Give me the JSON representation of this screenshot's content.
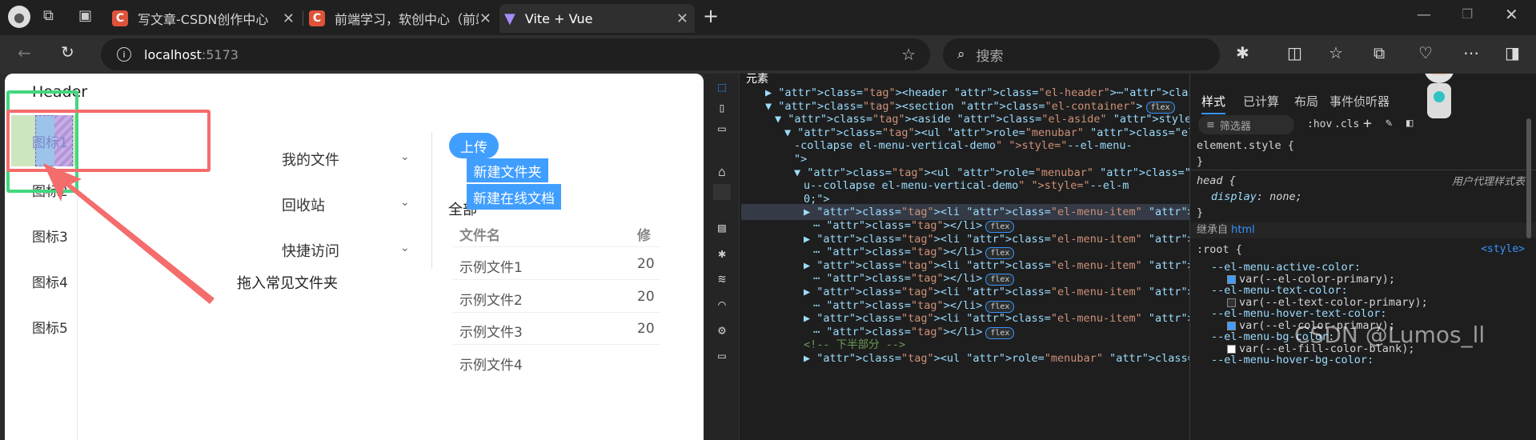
{
  "browser": {
    "tabs": [
      {
        "label": "写文章-CSDN创作中心",
        "favicon": "C"
      },
      {
        "label": "前端学习，软创中心（前端组）—",
        "favicon": "C"
      },
      {
        "label": "Vite + Vue",
        "favicon": "V"
      }
    ],
    "url_host": "localhost",
    "url_port": ":5173",
    "search_placeholder": "搜索"
  },
  "app": {
    "header": "Header",
    "aside_items": [
      "图标1",
      "图标2",
      "图标3",
      "图标4",
      "图标5"
    ],
    "menu_items": [
      "我的文件",
      "回收站",
      "快捷访问"
    ],
    "drag_hint": "拖入常见文件夹",
    "upload_button": "上传",
    "dropdown": [
      "新建文件夹",
      "新建在线文档"
    ],
    "all_files_label": "全部",
    "table_headers": [
      "文件名",
      "修"
    ],
    "table_rows": [
      {
        "name": "示例文件1",
        "date": "20"
      },
      {
        "name": "示例文件2",
        "date": "20"
      },
      {
        "name": "示例文件3",
        "date": "20"
      },
      {
        "name": "示例文件4",
        "date": ""
      }
    ]
  },
  "devtools": {
    "title": "元素",
    "code_lines": [
      {
        "indent": 0,
        "html": "▶ <header class=\"el-header\">⋯</header>"
      },
      {
        "indent": 0,
        "html": "▼ <section class=\"el-container\">",
        "pill": "flex"
      },
      {
        "indent": 1,
        "html": "▼ <aside class=\"el-aside\" style=\"--el-aside-width: 200"
      },
      {
        "indent": 2,
        "html": "▼ <ul role=\"menubar\" class=\"el-menu el-menu--vertica"
      },
      {
        "indent": 3,
        "html": "-collapse el-menu-vertical-demo\" style=\"--el-menu-"
      },
      {
        "indent": 3,
        "html": "\">"
      },
      {
        "indent": 3,
        "html": "▼ <ul role=\"menubar\" class=\"el-menu el-menu--verti"
      },
      {
        "indent": 4,
        "html": "u--collapse el-menu-vertical-demo\" style=\"--el-m"
      },
      {
        "indent": 4,
        "html": "0;\">"
      },
      {
        "indent": 4,
        "html": "▶ <li class=\"el-menu-item\" role=\"menuitem\" tabin"
      },
      {
        "indent": 5,
        "html": "⋯ </li>",
        "pill": "flex"
      },
      {
        "indent": 4,
        "html": "▶ <li class=\"el-menu-item\" role=\"menuitem\" tabin"
      },
      {
        "indent": 5,
        "html": "⋯ </li>",
        "pill": "flex"
      },
      {
        "indent": 4,
        "html": "▶ <li class=\"el-menu-item\" role=\"menuitem\" tabin"
      },
      {
        "indent": 5,
        "html": "⋯ </li>",
        "pill": "flex"
      },
      {
        "indent": 4,
        "html": "▶ <li class=\"el-menu-item\" role=\"menuitem\" tabin"
      },
      {
        "indent": 5,
        "html": "⋯ </li>",
        "pill": "flex"
      },
      {
        "indent": 4,
        "html": "▶ <li class=\"el-menu-item\" role=\"menuitem\" tabin"
      },
      {
        "indent": 5,
        "html": "⋯ </li>",
        "pill": "flex"
      },
      {
        "indent": 4,
        "html": "<!-- 下半部分 -->"
      },
      {
        "indent": 4,
        "html": "▶ <ul role=\"menubar\" class=\"el-menu el-menu--verti"
      }
    ],
    "style_tabs": [
      "样式",
      "已计算",
      "布局",
      "事件侦听器"
    ],
    "filter_placeholder": "筛选器",
    "hov": ":hov",
    "cls": ".cls",
    "element_style": "element.style {",
    "close_brace": "}",
    "head_rule": "head {",
    "ua_label": "用户代理样式表",
    "display_prop": "display",
    "display_val": "none;",
    "inherited": "继承自",
    "inherited_from": "html",
    "root_rule": ":root {",
    "style_src": "<style>",
    "vars": [
      {
        "name": "--el-menu-active-color:",
        "value": "var(--el-color-primary);",
        "swatch": "#409eff"
      },
      {
        "name": "--el-menu-text-color:",
        "value": "var(--el-text-color-primary);",
        "swatch": "#303133"
      },
      {
        "name": "--el-menu-hover-text-color:",
        "value": "var(--el-color-primary);",
        "swatch": "#409eff"
      },
      {
        "name": "--el-menu-bg-color:",
        "value": "var(--el-fill-color-blank);",
        "swatch": "#ffffff"
      },
      {
        "name": "--el-menu-hover-bg-color:",
        "value": "",
        "swatch": ""
      }
    ],
    "watermark": "CSDN @Lumos_ll"
  },
  "colors": {
    "accent": "#409eff",
    "annotation_red": "#f56c6c",
    "annotation_green": "#42d77d"
  }
}
